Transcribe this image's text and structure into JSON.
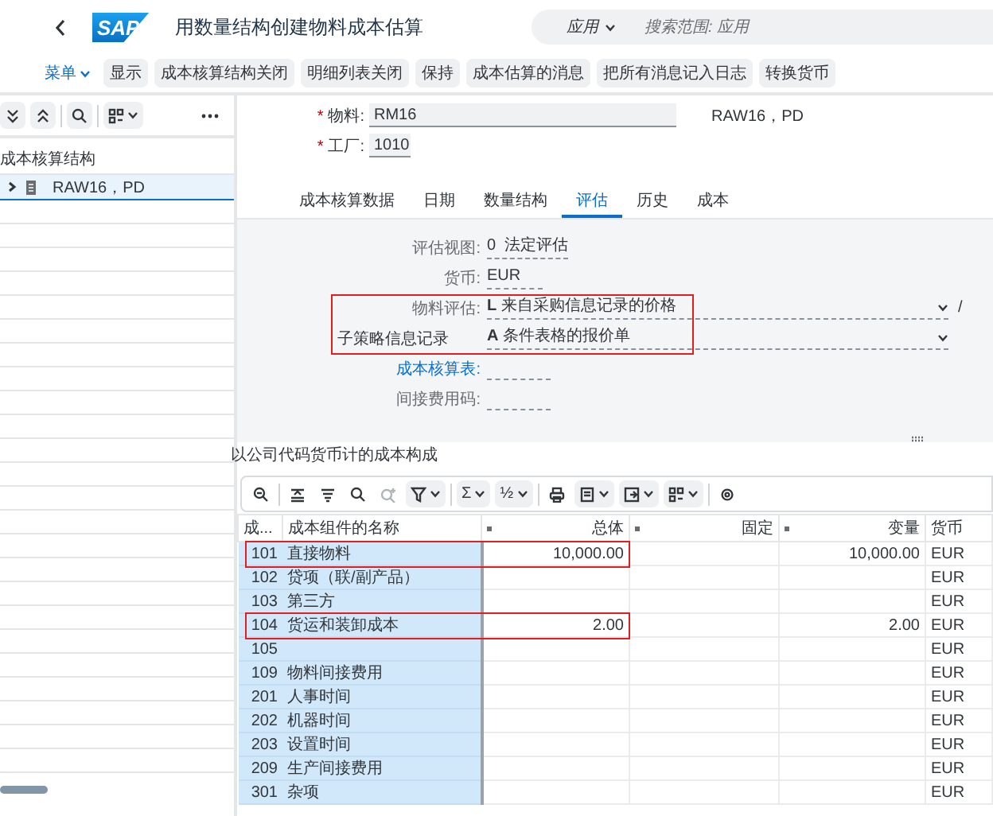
{
  "header": {
    "logo": "SAP",
    "title": "用数量结构创建物料成本估算",
    "search_scope": "应用",
    "search_placeholder": "搜索范围: 应用"
  },
  "toolbar": {
    "menu": "菜单",
    "buttons": [
      "显示",
      "成本核算结构关闭",
      "明细列表关闭",
      "保持",
      "成本估算的消息",
      "把所有消息记入日志",
      "转换货币"
    ]
  },
  "tree": {
    "header": "成本核算结构",
    "items": [
      {
        "label": "RAW16，PD",
        "selected": true,
        "expanded": false
      }
    ]
  },
  "header_fields": [
    {
      "label": "物料:",
      "required_mark": "*",
      "value": "RM16",
      "description": "RAW16，PD",
      "kind": "long"
    },
    {
      "label": "工厂:",
      "required_mark": "*",
      "value": "1010",
      "kind": "short"
    }
  ],
  "tabs": [
    {
      "label": "成本核算数据",
      "selected": false
    },
    {
      "label": "日期",
      "selected": false
    },
    {
      "label": "数量结构",
      "selected": false
    },
    {
      "label": "评估",
      "selected": true
    },
    {
      "label": "历史",
      "selected": false
    },
    {
      "label": "成本",
      "selected": false
    }
  ],
  "valuation_fields": [
    {
      "label": "评估视图:",
      "kind": "display",
      "code": "0",
      "text": "法定评估",
      "highlighted": false
    },
    {
      "label": "货币:",
      "kind": "display",
      "code": "EUR",
      "highlighted": false
    },
    {
      "label": "物料评估:",
      "kind": "dropdown",
      "code": "L",
      "text": "来自采购信息记录的价格",
      "suffix": "/",
      "highlighted": true
    },
    {
      "label": "子策略信息记录",
      "kind": "dropdown",
      "code": "A",
      "text": "条件表格的报价单",
      "highlighted": true
    },
    {
      "label": "成本核算表:",
      "kind": "empty",
      "link": true,
      "highlighted": false
    },
    {
      "label": "间接费用码:",
      "kind": "empty",
      "link": false,
      "highlighted": false
    }
  ],
  "cost_components": {
    "title": "以公司代码货币计的成本构成",
    "sum_glyph": "Σ",
    "subtotal_glyph": "½",
    "columns": [
      {
        "label": "成..."
      },
      {
        "label": "成本组件的名称"
      },
      {
        "label": "总体"
      },
      {
        "label": "固定"
      },
      {
        "label": "变量"
      },
      {
        "label": "货币"
      }
    ],
    "rows": [
      {
        "code": "101",
        "name": "直接物料",
        "total": "10,000.00",
        "variable": "10,000.00",
        "currency": "EUR",
        "highlighted": true
      },
      {
        "code": "102",
        "name": "贷项（联/副产品）",
        "currency": "EUR",
        "highlighted": false
      },
      {
        "code": "103",
        "name": "第三方",
        "currency": "EUR",
        "highlighted": false
      },
      {
        "code": "104",
        "name": "货运和装卸成本",
        "total": "2.00",
        "variable": "2.00",
        "currency": "EUR",
        "highlighted": true
      },
      {
        "code": "105",
        "currency": "EUR",
        "highlighted": false
      },
      {
        "code": "109",
        "name": "物料间接费用",
        "currency": "EUR",
        "highlighted": false
      },
      {
        "code": "201",
        "name": "人事时间",
        "currency": "EUR",
        "highlighted": false
      },
      {
        "code": "202",
        "name": "机器时间",
        "currency": "EUR",
        "highlighted": false
      },
      {
        "code": "203",
        "name": "设置时间",
        "currency": "EUR",
        "highlighted": false
      },
      {
        "code": "209",
        "name": "生产间接费用",
        "currency": "EUR",
        "highlighted": false
      },
      {
        "code": "301",
        "name": "杂项",
        "currency": "EUR",
        "highlighted": false
      }
    ]
  }
}
